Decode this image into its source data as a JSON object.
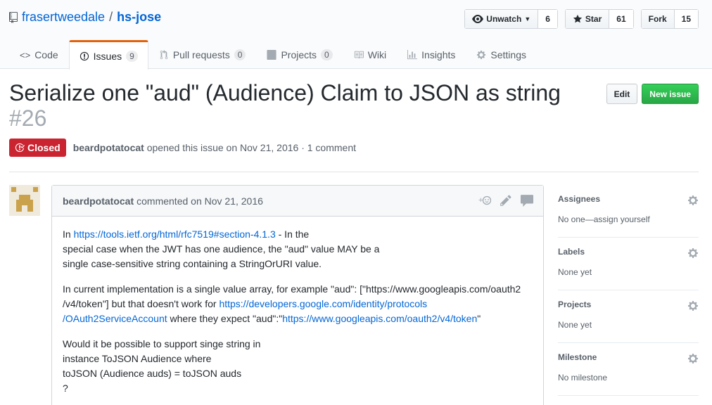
{
  "repo": {
    "owner": "frasertweedale",
    "separator": "/",
    "name": "hs-jose",
    "actions": [
      {
        "icon": "eye-icon",
        "label": "Unwatch",
        "count": "6"
      },
      {
        "icon": "star-icon",
        "label": "Star",
        "count": "61"
      },
      {
        "icon": "fork-icon",
        "label": "Fork",
        "count": "15"
      }
    ],
    "nav": {
      "code": {
        "label": "Code"
      },
      "issues": {
        "label": "Issues",
        "count": "9"
      },
      "pulls": {
        "label": "Pull requests",
        "count": "0"
      },
      "projects": {
        "label": "Projects",
        "count": "0"
      },
      "wiki": {
        "label": "Wiki"
      },
      "insights": {
        "label": "Insights"
      },
      "settings": {
        "label": "Settings"
      }
    }
  },
  "issue": {
    "title": "Serialize one \"aud\" (Audience) Claim to JSON as string",
    "number": "#26",
    "edit_label": "Edit",
    "new_issue_label": "New issue",
    "state": "Closed",
    "author": "beardpotatocat",
    "opened_text": "opened this issue on Nov 21, 2016 · 1 comment"
  },
  "comment": {
    "author": "beardpotatocat",
    "commented_text": "commented on Nov 21, 2016",
    "p1_pre": "In ",
    "p1_link": "https://tools.ietf.org/html/rfc7519#section-4.1.3",
    "p1_post": " - In the",
    "p1_line2": "special case when the JWT has one audience, the \"aud\" value MAY be a",
    "p1_line3": "single case-sensitive string containing a StringOrURI value.",
    "p2_pre": "In current implementation is a single value array, for example \"aud\": [\"https://www.googleapis.com/oauth2",
    "p2_line2_pre": "/v4/token\"] but that doesn't work for ",
    "p2_link1a": "https://developers.google.com/identity/protocols",
    "p2_link1b": "/OAuth2ServiceAccount",
    "p2_mid": " where they expect \"aud\":\"",
    "p2_link2": "https://www.googleapis.com/oauth2/v4/token",
    "p2_end": "\"",
    "p3_line1": "Would it be possible to support singe string in",
    "p3_line2": "instance ToJSON Audience where",
    "p3_line3": "toJSON (Audience auds) = toJSON auds",
    "p3_line4": "?"
  },
  "sidebar": {
    "assignees": {
      "heading": "Assignees",
      "value": "No one—assign yourself"
    },
    "labels": {
      "heading": "Labels",
      "value": "None yet"
    },
    "projects": {
      "heading": "Projects",
      "value": "None yet"
    },
    "milestone": {
      "heading": "Milestone",
      "value": "No milestone"
    }
  },
  "colors": {
    "link": "#0366d6",
    "closed": "#cb2431",
    "new_issue": "#28a745",
    "selected_tab": "#e36209"
  }
}
